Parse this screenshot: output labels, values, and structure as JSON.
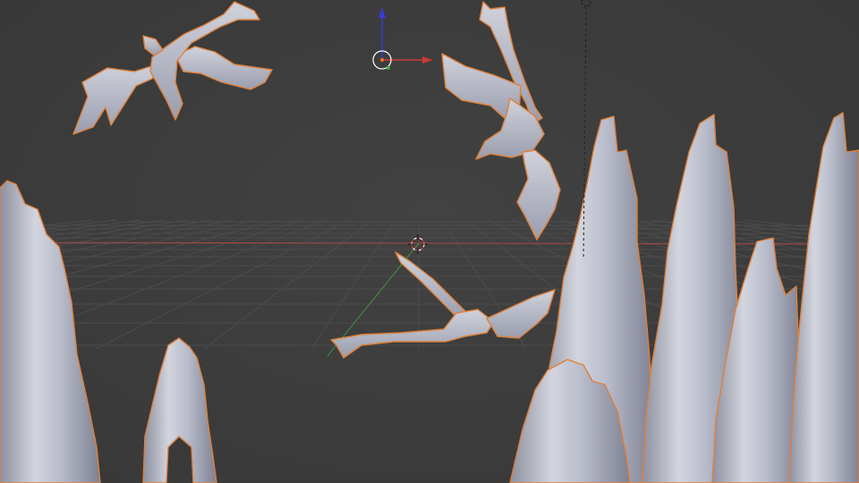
{
  "viewport": {
    "view_mode": "solid",
    "selection_state": "selected",
    "colors": {
      "background": "#3d3d3d",
      "grid_line": "#4c4c4c",
      "x_axis": "#b84848",
      "y_axis": "#4a9a4a",
      "z_axis": "#3a3ad8",
      "mesh_fill": "#c4c6d2",
      "mesh_shadow": "#8d90a0",
      "selection_outline": "#e0803a"
    }
  },
  "scene_objects": [
    {
      "name": "dragon",
      "kind": "mesh"
    },
    {
      "name": "dragon",
      "kind": "mesh"
    },
    {
      "name": "dragon",
      "kind": "mesh"
    },
    {
      "name": "rock_spire",
      "kind": "mesh"
    },
    {
      "name": "rock_spire",
      "kind": "mesh"
    },
    {
      "name": "rock_spire",
      "kind": "mesh"
    },
    {
      "name": "rock_spire",
      "kind": "mesh"
    },
    {
      "name": "rock_spire",
      "kind": "mesh"
    },
    {
      "name": "rock_spire",
      "kind": "mesh"
    }
  ],
  "gizmos": {
    "transform": "move-arrows-icon",
    "cursor": "3d-cursor-icon",
    "light": "lamp-icon"
  }
}
